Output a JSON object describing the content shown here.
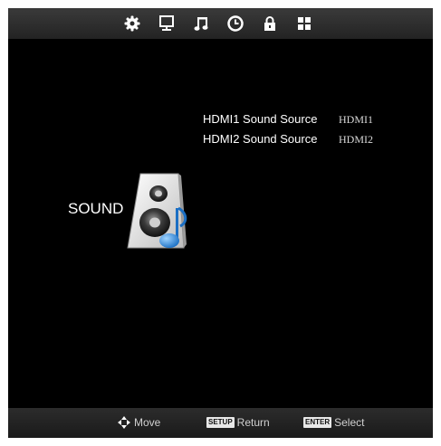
{
  "tabs": [
    {
      "icon": "gear-icon"
    },
    {
      "icon": "monitor-icon"
    },
    {
      "icon": "music-note-icon"
    },
    {
      "icon": "clock-icon"
    },
    {
      "icon": "lock-icon"
    },
    {
      "icon": "grid-icon"
    }
  ],
  "page": {
    "title": "SOUND",
    "icon": "speaker-icon"
  },
  "menu": {
    "items": [
      {
        "label": "HDMI1 Sound Source",
        "value": "HDMI1"
      },
      {
        "label": "HDMI2 Sound Source",
        "value": "HDMI2"
      }
    ]
  },
  "footer": {
    "move_label": "Move",
    "setup_key": "SETUP",
    "return_label": "Return",
    "enter_key": "ENTER",
    "select_label": "Select"
  },
  "colors": {
    "background": "#000000",
    "accent": "#2f8fe0"
  }
}
